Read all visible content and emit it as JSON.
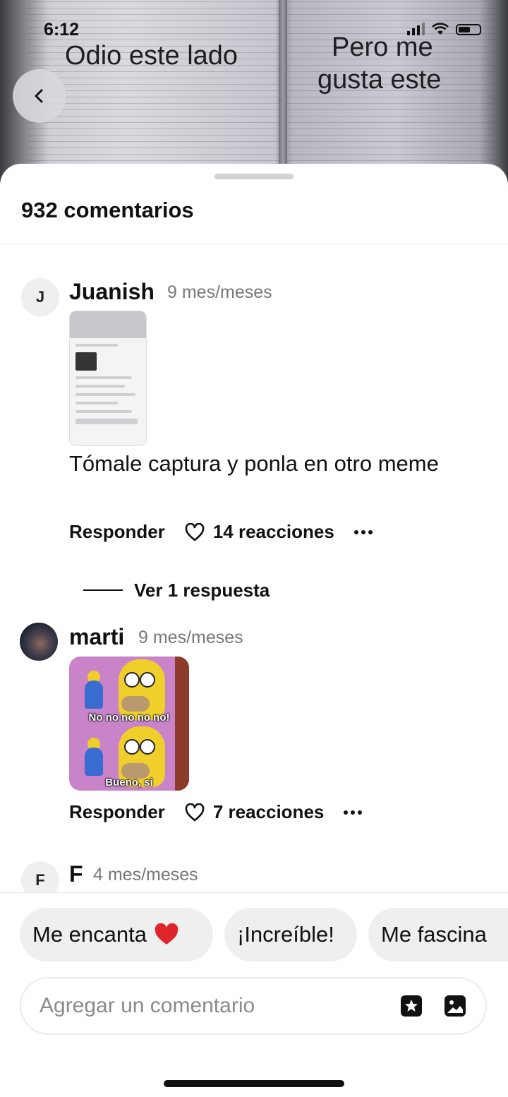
{
  "status_bar": {
    "time": "6:12"
  },
  "background_image": {
    "left_text": "Odio este lado",
    "right_text_line1": "Pero me",
    "right_text_line2": "gusta este"
  },
  "sheet": {
    "title": "932 comentarios",
    "comments": [
      {
        "avatar_letter": "J",
        "username": "Juanish",
        "time": "9 mes/meses",
        "text": "Tómale captura y ponla en otro meme",
        "reply_label": "Responder",
        "reactions": "14 reacciones",
        "replies_link": "Ver 1 respuesta"
      },
      {
        "username": "marti",
        "time": "9 mes/meses",
        "meme_caption_top": "No no no no no!",
        "meme_caption_bottom": "Bueno, si",
        "reply_label": "Responder",
        "reactions": "7 reacciones"
      },
      {
        "avatar_letter": "F",
        "username": "F",
        "time": "4 mes/meses"
      }
    ],
    "quick_reactions": [
      "Me encanta",
      "¡Increíble!",
      "Me fascina"
    ],
    "comment_input": {
      "placeholder": "Agregar un comentario",
      "value": ""
    }
  },
  "colors": {
    "accent_heart": "#e0242b",
    "chip_bg": "#efefef",
    "muted_text": "#777777"
  }
}
